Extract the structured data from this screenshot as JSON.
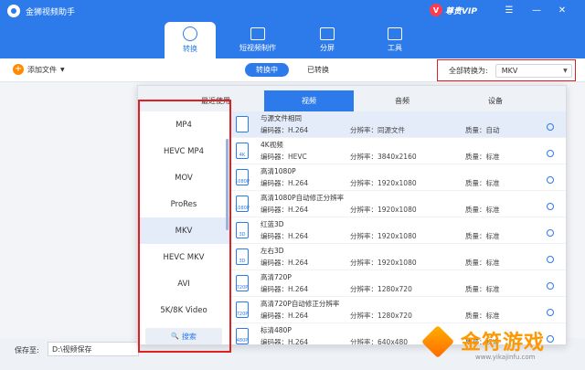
{
  "app": {
    "title": "金狮视频助手"
  },
  "titlebar": {
    "vip_label": "尊贵VIP",
    "vip_badge": "V"
  },
  "window_controls": [
    "☰",
    "—",
    "✕"
  ],
  "nav": {
    "tabs": [
      {
        "label": "转换",
        "icon": "convert-icon",
        "active": true
      },
      {
        "label": "短视频制作",
        "icon": "tv-icon",
        "active": false
      },
      {
        "label": "分屏",
        "icon": "split-screen-icon",
        "active": false
      },
      {
        "label": "工具",
        "icon": "toolbox-icon",
        "active": false
      }
    ]
  },
  "toolbar": {
    "add_file_label": "添加文件",
    "add_file_caret": "▼",
    "segments": [
      "转换中",
      "已转换"
    ],
    "convert_all_label": "全部转换为:",
    "convert_all_value": "MKV"
  },
  "bottom": {
    "save_label": "保存至:",
    "save_path": "D:\\视频保存"
  },
  "popup": {
    "tabs": [
      "最近使用",
      "视频",
      "音频",
      "设备"
    ],
    "active_tab": "视频",
    "formats": [
      "MP4",
      "HEVC MP4",
      "MOV",
      "ProRes",
      "MKV",
      "HEVC MKV",
      "AVI",
      "5K/8K Video"
    ],
    "selected_format": "MKV",
    "search_label": "搜索",
    "search_icon": "🔍",
    "presets": [
      {
        "name": "与源文件相同",
        "encoder": "编码器：H.264",
        "resolution": "分辨率：同源文件",
        "quality": "质量：自动",
        "badge": ""
      },
      {
        "name": "4K视频",
        "encoder": "编码器：HEVC",
        "resolution": "分辨率：3840x2160",
        "quality": "质量：标准",
        "badge": "4K"
      },
      {
        "name": "高清1080P",
        "encoder": "编码器：H.264",
        "resolution": "分辨率：1920x1080",
        "quality": "质量：标准",
        "badge": "1080P"
      },
      {
        "name": "高清1080P自动修正分辨率",
        "encoder": "编码器：H.264",
        "resolution": "分辨率：1920x1080",
        "quality": "质量：标准",
        "badge": "1080P"
      },
      {
        "name": "红蓝3D",
        "encoder": "编码器：H.264",
        "resolution": "分辨率：1920x1080",
        "quality": "质量：标准",
        "badge": "3D"
      },
      {
        "name": "左右3D",
        "encoder": "编码器：H.264",
        "resolution": "分辨率：1920x1080",
        "quality": "质量：标准",
        "badge": "3D"
      },
      {
        "name": "高清720P",
        "encoder": "编码器：H.264",
        "resolution": "分辨率：1280x720",
        "quality": "质量：标准",
        "badge": "720P"
      },
      {
        "name": "高清720P自动修正分辨率",
        "encoder": "编码器：H.264",
        "resolution": "分辨率：1280x720",
        "quality": "质量：标准",
        "badge": "720P"
      },
      {
        "name": "标清480P",
        "encoder": "编码器：H.264",
        "resolution": "分辨率：640x480",
        "quality": "质量：标准",
        "badge": "480P"
      }
    ]
  },
  "watermark": {
    "text": "金符游戏",
    "url": "www.yikajinfu.com"
  },
  "colors": {
    "primary": "#2d7bea",
    "highlight_red": "#e02020",
    "orange": "#ff8a00"
  }
}
